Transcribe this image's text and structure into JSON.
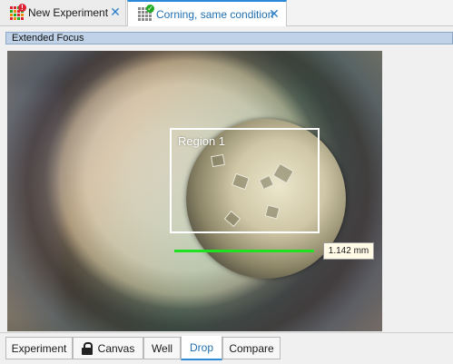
{
  "doc_tabs": [
    {
      "label": "New Experiment",
      "icon": "experiment-grid-icon",
      "active": false
    },
    {
      "label": "Corning, same condition",
      "icon": "plate-grid-check-icon",
      "active": true
    }
  ],
  "panel": {
    "title": "Extended Focus"
  },
  "viewer": {
    "region_label": "Region 1",
    "scale_label": "1.142 mm",
    "scale_color": "#1fe11f"
  },
  "bottom_tabs": [
    {
      "label": "Experiment",
      "active": false
    },
    {
      "label": "Canvas",
      "icon": "lock-icon",
      "active": false
    },
    {
      "label": "Well",
      "active": false
    },
    {
      "label": "Drop",
      "active": true
    },
    {
      "label": "Compare",
      "active": false
    }
  ],
  "colors": {
    "accent": "#2b8bd8",
    "header": "#bfd2e8"
  }
}
